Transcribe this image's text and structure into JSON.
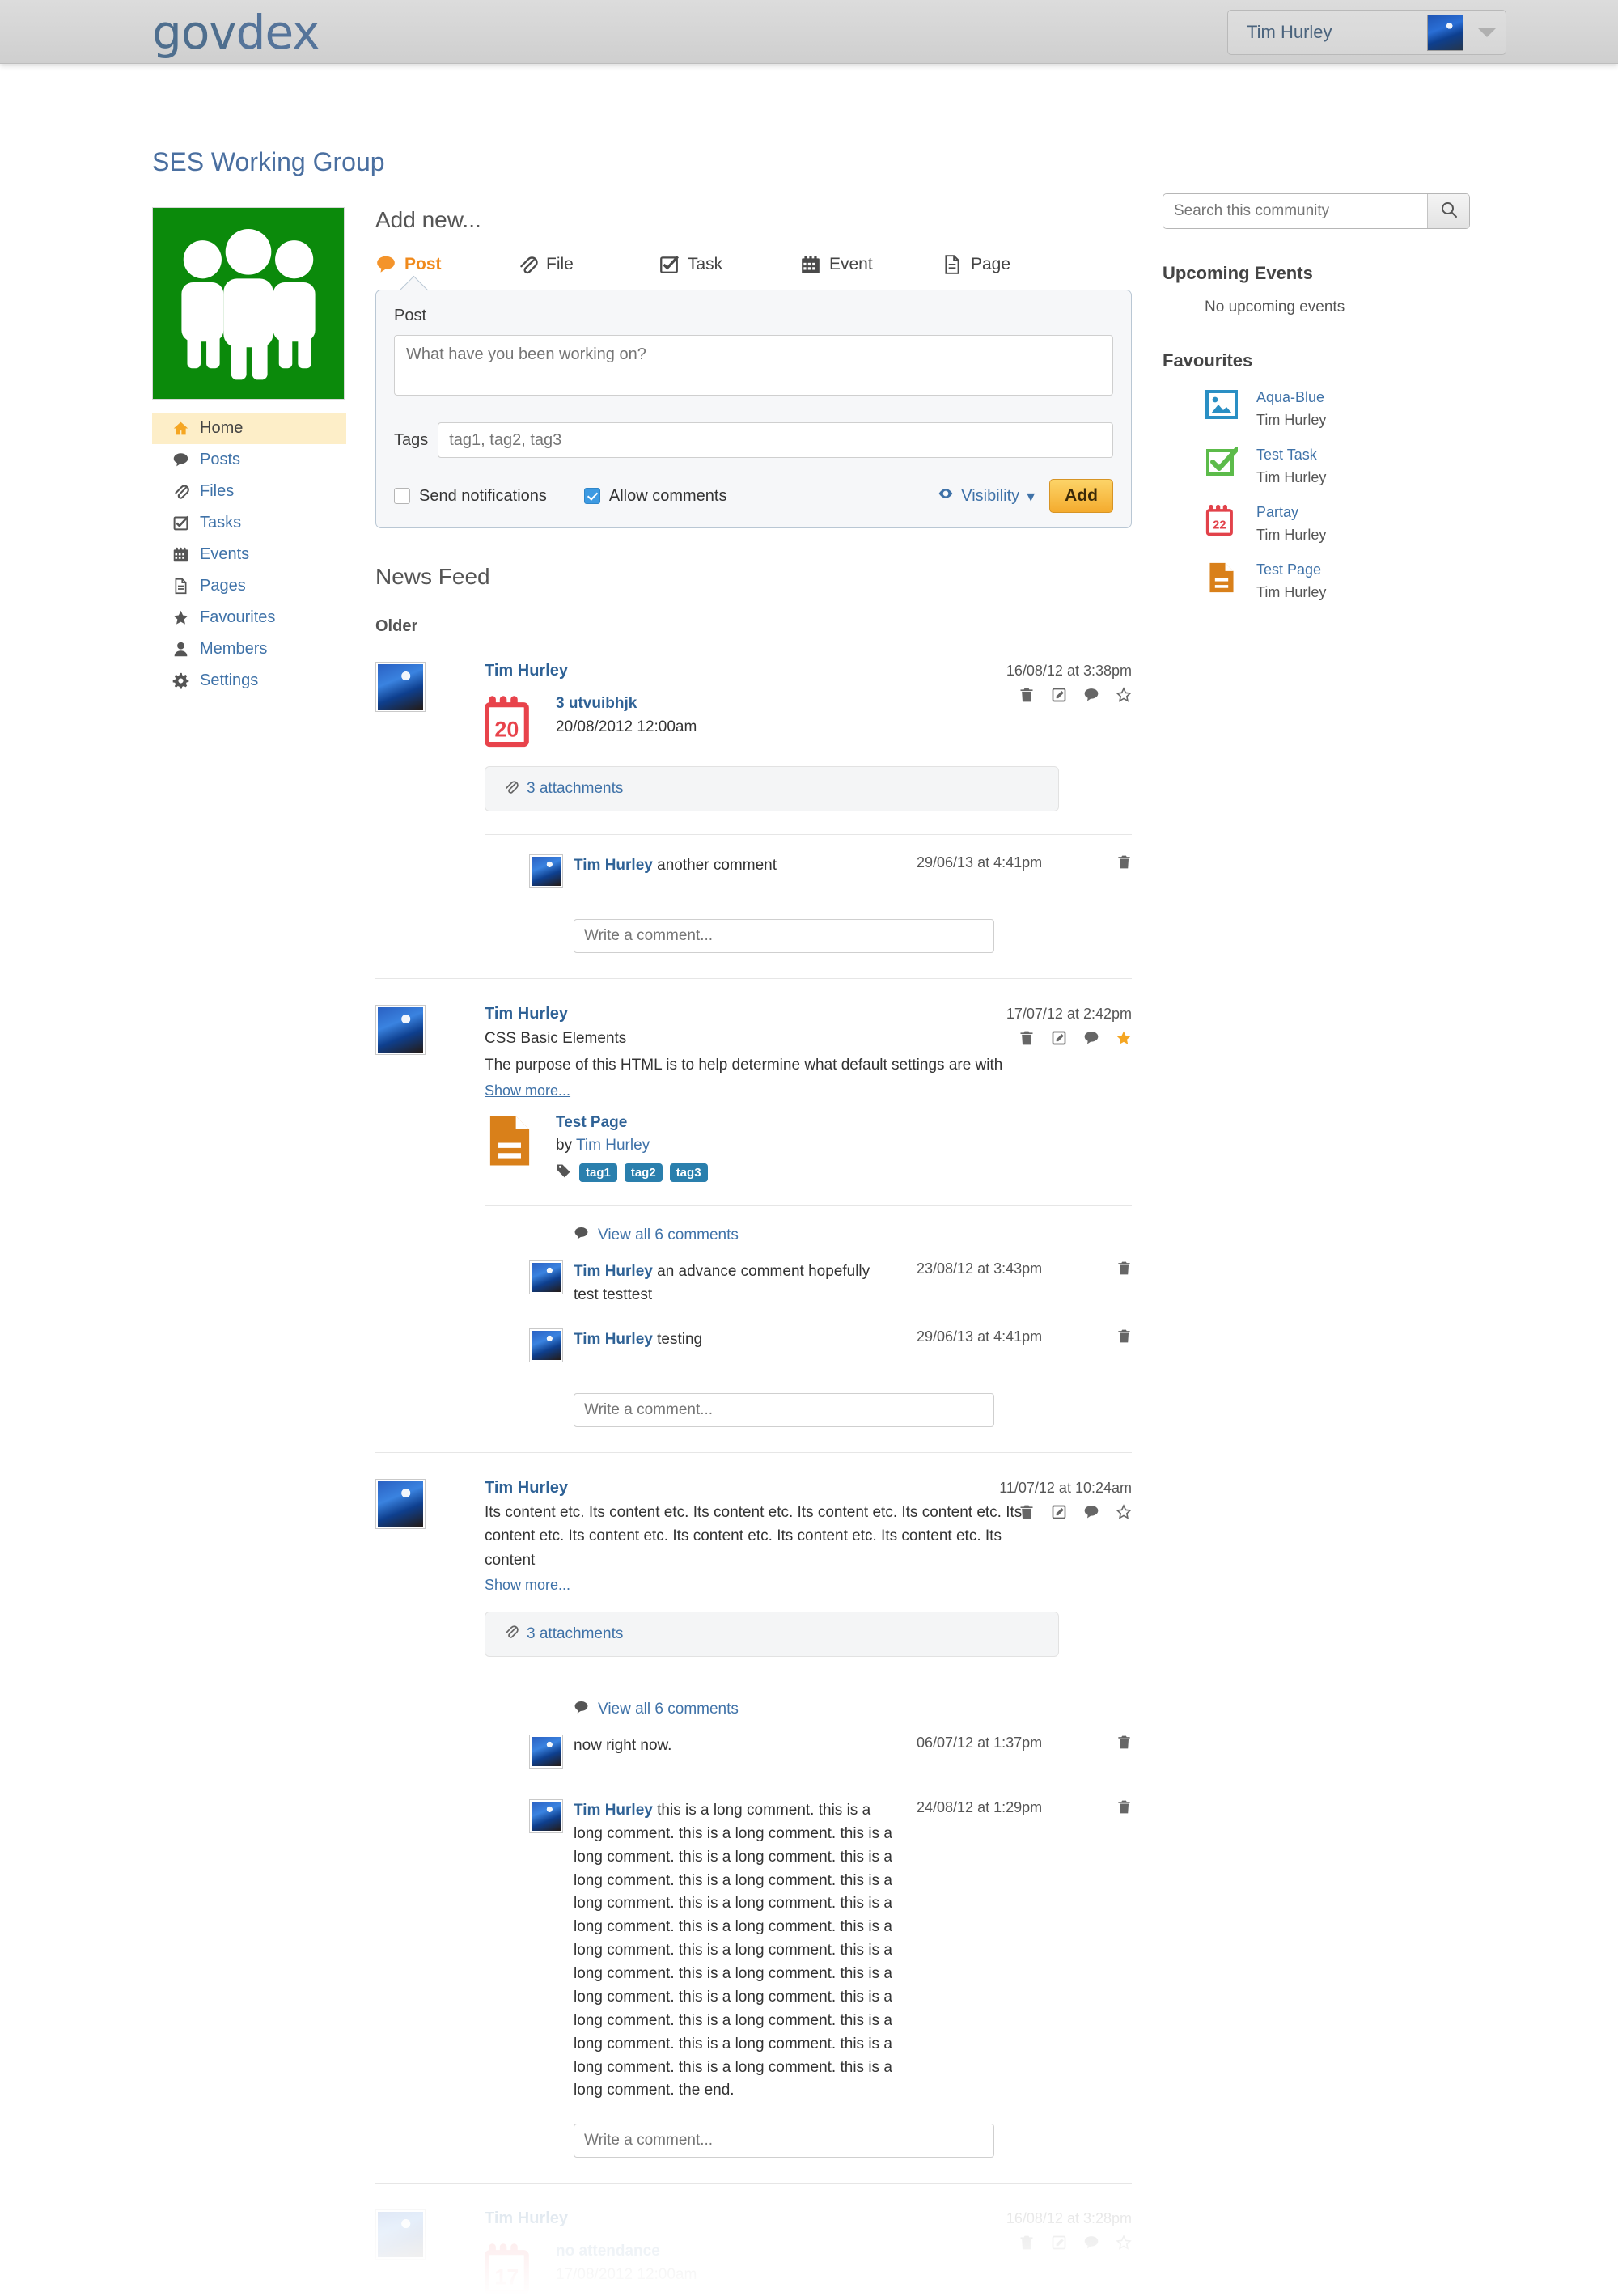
{
  "brand": {
    "part1": "gov",
    "part2": "dex"
  },
  "topbar": {
    "user_name": "Tim Hurley",
    "user_avatar": "car-avatar",
    "caret": "chevron-down-icon"
  },
  "page": {
    "title": "SES Working Group"
  },
  "sidebar": {
    "group_avatar": "three-people-icon",
    "items": [
      {
        "label": "Home",
        "icon": "home-icon",
        "active": true
      },
      {
        "label": "Posts",
        "icon": "comment-icon",
        "active": false
      },
      {
        "label": "Files",
        "icon": "paperclip-icon",
        "active": false
      },
      {
        "label": "Tasks",
        "icon": "check-square-icon",
        "active": false
      },
      {
        "label": "Events",
        "icon": "calendar-icon",
        "active": false
      },
      {
        "label": "Pages",
        "icon": "page-icon",
        "active": false
      },
      {
        "label": "Favourites",
        "icon": "star-icon",
        "active": false
      },
      {
        "label": "Members",
        "icon": "user-icon",
        "active": false
      },
      {
        "label": "Settings",
        "icon": "gear-icon",
        "active": false
      }
    ]
  },
  "composer": {
    "heading": "Add new...",
    "tabs": [
      {
        "label": "Post",
        "icon": "comment-icon",
        "active": true
      },
      {
        "label": "File",
        "icon": "paperclip-icon",
        "active": false
      },
      {
        "label": "Task",
        "icon": "check-square-icon",
        "active": false
      },
      {
        "label": "Event",
        "icon": "calendar-icon",
        "active": false
      },
      {
        "label": "Page",
        "icon": "page-icon",
        "active": false
      }
    ],
    "panel_label": "Post",
    "text_placeholder": "What have you been working on?",
    "tags_label": "Tags",
    "tags_placeholder": "tag1, tag2, tag3",
    "send_notifications_label": "Send notifications",
    "send_notifications_checked": false,
    "allow_comments_label": "Allow comments",
    "allow_comments_checked": true,
    "visibility_label": "Visibility",
    "visibility_icon": "eye-icon",
    "add_label": "Add",
    "add_color": "#f4ab2e"
  },
  "feed": {
    "title": "News Feed",
    "group_label": "Older",
    "comment_placeholder": "Write a comment...",
    "posts": [
      {
        "author": "Tim Hurley",
        "time": "16/08/12 at 3:38pm",
        "starred": false,
        "object": {
          "icon": "calendar-icon-red",
          "icon_day": "20",
          "title": "3 utvuibhjk",
          "date": "20/08/2012 12:00am"
        },
        "attachments": "3 attachments",
        "comments": [
          {
            "author": "Tim Hurley",
            "text": "another comment",
            "time": "29/06/13 at 4:41pm"
          }
        ]
      },
      {
        "author": "Tim Hurley",
        "time": "17/07/12 at 2:42pm",
        "starred": true,
        "title": "CSS Basic Elements",
        "body": "The purpose of this HTML is to help determine what default settings are with",
        "show_more": "Show more...",
        "object": {
          "icon": "page-icon-orange",
          "title": "Test Page",
          "by_label": "by",
          "by_author": "Tim Hurley",
          "tags": [
            "tag1",
            "tag2",
            "tag3"
          ]
        },
        "view_all": "View all 6 comments",
        "comments": [
          {
            "author": "Tim Hurley",
            "text": "an advance comment hopefully test testtest",
            "time": "23/08/12 at 3:43pm"
          },
          {
            "author": "Tim Hurley",
            "text": "testing",
            "time": "29/06/13 at 4:41pm"
          }
        ]
      },
      {
        "author": "Tim Hurley",
        "time": "11/07/12 at 10:24am",
        "starred": false,
        "body": "Its content etc. Its content etc. Its content etc. Its content etc. Its content etc. Its content etc. Its content etc. Its content etc. Its content etc. Its content etc. Its content",
        "show_more": "Show more...",
        "attachments": "3 attachments",
        "view_all": "View all 6 comments",
        "comments": [
          {
            "author": "",
            "text": "now right now.",
            "time": "06/07/12 at 1:37pm"
          },
          {
            "author": "Tim Hurley",
            "text": "this is a long comment. this is a long comment. this is a long comment. this is a long comment. this is a long comment. this is a long comment. this is a long comment. this is a long comment. this is a long comment. this is a long comment. this is a long comment. this is a long comment. this is a long comment. this is a long comment. this is a long comment. this is a long comment. this is a long comment. this is a long comment. this is a long comment. this is a long comment. this is a long comment. this is a long comment. this is a long comment. this is a long comment. the end.",
            "time": "24/08/12 at 1:29pm"
          }
        ]
      },
      {
        "author": "Tim Hurley",
        "time": "16/08/12 at 3:28pm",
        "starred": false,
        "faded": true,
        "object": {
          "icon": "calendar-icon-red",
          "icon_day": "17",
          "title": "no attendance",
          "date": "17/08/2012 12:00am"
        }
      }
    ]
  },
  "right": {
    "search_placeholder": "Search this community",
    "search_icon": "search-icon",
    "upcoming_events_heading": "Upcoming Events",
    "no_events_text": "No upcoming events",
    "favourites_heading": "Favourites",
    "favourites": [
      {
        "title": "Aqua-Blue",
        "owner": "Tim Hurley",
        "icon": "image-icon",
        "color": "#2a8fc4"
      },
      {
        "title": "Test Task",
        "owner": "Tim Hurley",
        "icon": "check-square-icon",
        "color": "#5cbb4a"
      },
      {
        "title": "Partay",
        "owner": "Tim Hurley",
        "icon": "calendar-icon",
        "day": "22",
        "color": "#e2424a"
      },
      {
        "title": "Test Page",
        "owner": "Tim Hurley",
        "icon": "page-icon",
        "color": "#d9801a"
      }
    ]
  }
}
